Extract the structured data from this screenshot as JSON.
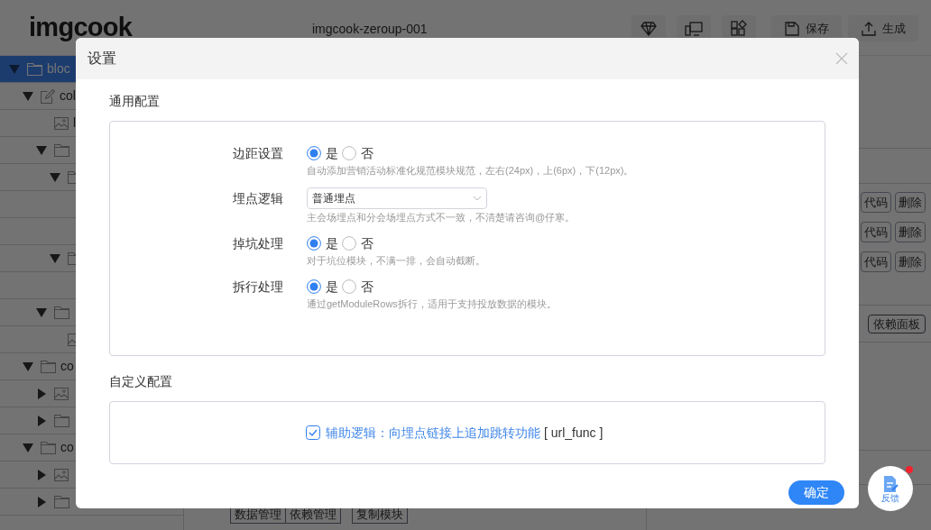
{
  "app": {
    "logo": "imgcook",
    "project_title": "imgcook-zeroup-001",
    "toolbar_buttons": [
      "保存",
      "生成"
    ]
  },
  "tree": [
    {
      "label": "bloc",
      "kind": "folder",
      "expanded": true,
      "selected": true,
      "children": [
        {
          "label": "col",
          "kind": "edit",
          "expanded": true,
          "selected": false,
          "children": [
            {
              "label": "l",
              "kind": "image",
              "selected": false
            },
            {
              "kind": "folder",
              "expanded": true,
              "selected": false,
              "children": [
                {
                  "kind": "folder",
                  "expanded": true,
                  "selected": false,
                  "children": [
                    {
                      "selected": false
                    },
                    {
                      "selected": false
                    }
                  ]
                },
                {
                  "kind": "folder",
                  "expanded": true,
                  "selected": false,
                  "children": [
                    {
                      "selected": false
                    }
                  ]
                }
              ]
            },
            {
              "kind": "folder",
              "expanded": true,
              "selected": false,
              "children": [
                {
                  "kind": "image",
                  "selected": false
                }
              ]
            }
          ]
        },
        {
          "label": "co",
          "kind": "folder",
          "expanded": true,
          "selected": false,
          "children": [
            {
              "kind": "image",
              "expanded": false,
              "selected": false
            },
            {
              "kind": "folder",
              "expanded": false,
              "selected": false
            }
          ]
        },
        {
          "label": "co",
          "kind": "folder",
          "expanded": true,
          "selected": false,
          "children": [
            {
              "kind": "image",
              "expanded": false,
              "selected": false
            },
            {
              "kind": "folder",
              "expanded": false,
              "selected": false
            }
          ]
        }
      ]
    }
  ],
  "panel_rows": [
    {
      "buttons": [
        "代码",
        "删除"
      ]
    },
    {
      "buttons": [
        "代码",
        "删除"
      ]
    },
    {
      "buttons": [
        "代码",
        "删除"
      ]
    }
  ],
  "dependency_button": "依赖面板",
  "bottom_buttons": [
    "数据管理",
    "依赖管理",
    "复制模块"
  ],
  "dialog": {
    "title": "设置",
    "sections": [
      {
        "title": "通用配置",
        "kind": "form",
        "rows": [
          {
            "label": "边距设置",
            "kind": "radio",
            "options": [
              {
                "label": "是",
                "selected": true
              },
              {
                "label": "否",
                "selected": false
              }
            ],
            "help": "自动添加营销活动标准化规范模块规范，左右(24px)，上(6px)，下(12px)。"
          },
          {
            "label": "埋点逻辑",
            "kind": "select",
            "value": "普通埋点",
            "help": "主会场埋点和分会场埋点方式不一致，不清楚请咨询@仔寒。"
          },
          {
            "label": "掉坑处理",
            "kind": "radio",
            "options": [
              {
                "label": "是",
                "selected": true
              },
              {
                "label": "否",
                "selected": false
              }
            ],
            "help": "对于坑位模块，不满一排，会自动截断。"
          },
          {
            "label": "拆行处理",
            "kind": "radio",
            "options": [
              {
                "label": "是",
                "selected": true
              },
              {
                "label": "否",
                "selected": false
              }
            ],
            "help": "通过getModuleRows拆行，适用于支持投放数据的模块。"
          }
        ]
      },
      {
        "title": "自定义配置",
        "kind": "checks",
        "items": [
          {
            "label": "辅助逻辑：向埋点链接上追加跳转功能",
            "code": "[ url_func ]",
            "checked": true
          }
        ]
      }
    ],
    "ok_button": "确定"
  },
  "feedback": {
    "label": "反馈",
    "badge": true
  }
}
